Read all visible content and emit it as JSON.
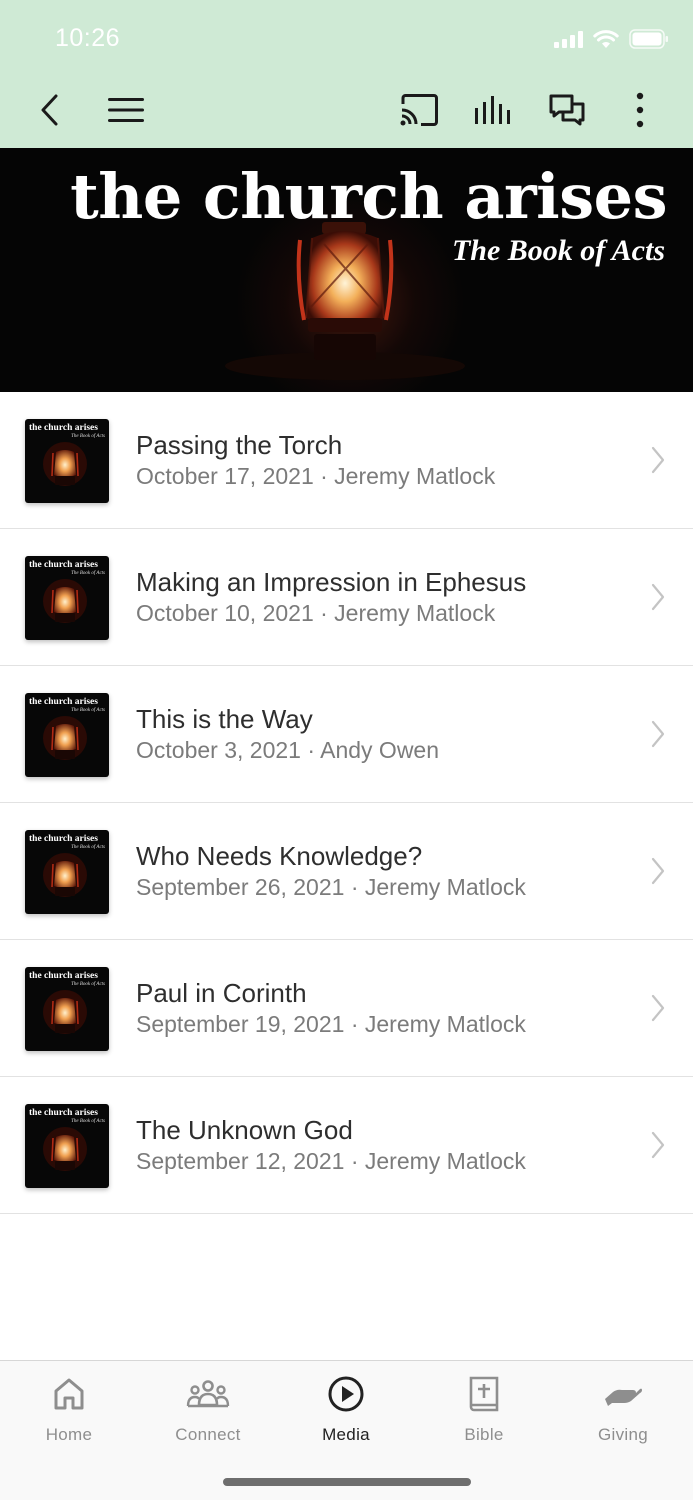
{
  "status": {
    "time": "10:26"
  },
  "hero": {
    "title": "the church arises",
    "subtitle": "The Book of Acts"
  },
  "thumbnail": {
    "title": "the church arises",
    "subtitle": "The Book of Acts"
  },
  "sermons": [
    {
      "title": "Passing the Torch",
      "meta": "October 17, 2021 · Jeremy Matlock"
    },
    {
      "title": "Making an Impression in Ephesus",
      "meta": "October 10, 2021 · Jeremy Matlock"
    },
    {
      "title": "This is the Way",
      "meta": "October 3, 2021 · Andy Owen"
    },
    {
      "title": "Who Needs Knowledge?",
      "meta": "September 26, 2021 · Jeremy Matlock"
    },
    {
      "title": "Paul in Corinth",
      "meta": "September 19, 2021 · Jeremy Matlock"
    },
    {
      "title": "The Unknown God",
      "meta": "September 12, 2021 · Jeremy Matlock"
    }
  ],
  "tabs": [
    {
      "label": "Home",
      "icon": "home-icon",
      "active": false
    },
    {
      "label": "Connect",
      "icon": "people-icon",
      "active": false
    },
    {
      "label": "Media",
      "icon": "play-circle-icon",
      "active": true
    },
    {
      "label": "Bible",
      "icon": "bible-icon",
      "active": false
    },
    {
      "label": "Giving",
      "icon": "giving-hand-icon",
      "active": false
    }
  ],
  "colors": {
    "header_bg": "#cfead5",
    "hero_bg": "#050505",
    "active_tab": "#222222",
    "inactive_tab": "#8e8e8e"
  }
}
